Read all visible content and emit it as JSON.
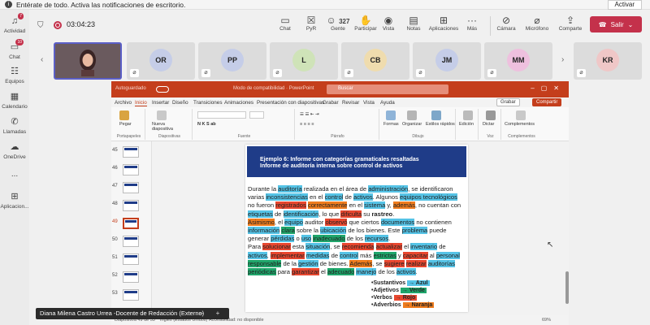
{
  "notification": {
    "text": "Entérate de todo. Activa las notificaciones de escritorio.",
    "activate_label": "Activar"
  },
  "rail": [
    {
      "label": "Actividad",
      "icon": "bell-icon",
      "badge": "7"
    },
    {
      "label": "Chat",
      "icon": "chat-icon",
      "badge": "10"
    },
    {
      "label": "Equipos",
      "icon": "teams-icon",
      "badge": ""
    },
    {
      "label": "Calendario",
      "icon": "calendar-icon",
      "badge": ""
    },
    {
      "label": "Llamadas",
      "icon": "phone-icon",
      "badge": ""
    },
    {
      "label": "OneDrive",
      "icon": "cloud-icon",
      "badge": ""
    },
    {
      "label": "...",
      "icon": "more-icon",
      "badge": ""
    },
    {
      "label": "Aplicacion...",
      "icon": "add-app-icon",
      "badge": ""
    }
  ],
  "meeting": {
    "timer": "03:04:23",
    "toolbar": {
      "chat": "Chat",
      "pyr": "PyR",
      "people_count": "327",
      "people": "Gente",
      "participate": "Participar",
      "view": "Vista",
      "notes": "Notas",
      "apps": "Aplicaciones",
      "more": "Más",
      "camera": "Cámara",
      "mic": "Micrófono",
      "share": "Comparte",
      "leave": "Salir"
    }
  },
  "participants": [
    {
      "initials": "",
      "self": true
    },
    {
      "initials": "OR",
      "color": "#c5cde8"
    },
    {
      "initials": "PP",
      "color": "#c5cde8"
    },
    {
      "initials": "L",
      "color": "#cfe3b8"
    },
    {
      "initials": "CB",
      "color": "#efdcae"
    },
    {
      "initials": "JM",
      "color": "#c5cde8"
    },
    {
      "initials": "MM",
      "color": "#eec0de"
    },
    {
      "initials": "KR",
      "color": "#efc7c7"
    }
  ],
  "powerpoint": {
    "autosave": "Autoguardado",
    "filename": "Modo de compatibilidad · PowerPoint",
    "search": "Buscar",
    "tabs": [
      "Archivo",
      "Inicio",
      "Insertar",
      "Diseño",
      "Transiciones",
      "Animaciones",
      "Presentación con diapositivas",
      "Grabar",
      "Revisar",
      "Vista",
      "Ayuda"
    ],
    "record_btn": "Grabar",
    "share_btn": "Compartir",
    "ribbon": {
      "paste": "Pegar",
      "clipboard": "Portapapeles",
      "new_slide": "Nueva diapositiva",
      "slides": "Diapositivas",
      "font": "Fuente",
      "paragraph": "Párrafo",
      "shapes": "Formas",
      "arrange": "Organizar",
      "styles": "Estilos rápidos",
      "drawing": "Dibujo",
      "edit": "Edición",
      "dictate": "Dictar",
      "voice": "Voz",
      "addins": "Complementos",
      "addins_group": "Complementos"
    },
    "thumbnails": [
      "45",
      "46",
      "47",
      "48",
      "49",
      "50",
      "51",
      "52",
      "53"
    ],
    "selected_thumb": "49",
    "slide": {
      "title1": "Ejemplo 6: Informe con categorías gramaticales resaltadas",
      "title2": "Informe de auditoría interna sobre control de activos",
      "p1": [
        {
          "t": "Durante la ",
          "h": ""
        },
        {
          "t": "auditoría",
          "h": "b"
        },
        {
          "t": " realizada en el área de ",
          "h": ""
        },
        {
          "t": "administración",
          "h": "b"
        },
        {
          "t": ", se identificaron varias ",
          "h": ""
        },
        {
          "t": "inconsistencias",
          "h": "b"
        },
        {
          "t": " en el ",
          "h": ""
        },
        {
          "t": "control",
          "h": "b"
        },
        {
          "t": " de ",
          "h": ""
        },
        {
          "t": "activos",
          "h": "b"
        },
        {
          "t": ". Algunos ",
          "h": ""
        },
        {
          "t": "equipos tecnológicos",
          "h": "b"
        },
        {
          "t": " no fueron ",
          "h": ""
        },
        {
          "t": "registrados",
          "h": "r"
        },
        {
          "t": " ",
          "h": ""
        },
        {
          "t": "correctamente",
          "h": "o"
        },
        {
          "t": " en el ",
          "h": ""
        },
        {
          "t": "sistema",
          "h": "b"
        },
        {
          "t": " y, ",
          "h": ""
        },
        {
          "t": "además",
          "h": "o"
        },
        {
          "t": ", no cuentan con ",
          "h": ""
        },
        {
          "t": "etiquetas",
          "h": "b"
        },
        {
          "t": " de ",
          "h": ""
        },
        {
          "t": "identificación",
          "h": "b"
        },
        {
          "t": ", lo que ",
          "h": ""
        },
        {
          "t": "dificulta",
          "h": "r"
        },
        {
          "t": " su ",
          "h": ""
        },
        {
          "t": "rastreo",
          "h": "bold"
        },
        {
          "t": ".",
          "h": ""
        }
      ],
      "p2": [
        {
          "t": "Asimismo",
          "h": "o"
        },
        {
          "t": ", el ",
          "h": ""
        },
        {
          "t": "equipo",
          "h": "b"
        },
        {
          "t": " auditor ",
          "h": ""
        },
        {
          "t": "observó",
          "h": "r"
        },
        {
          "t": " que ciertos ",
          "h": ""
        },
        {
          "t": "documentos",
          "h": "b"
        },
        {
          "t": " no contienen ",
          "h": ""
        },
        {
          "t": "información",
          "h": "b"
        },
        {
          "t": " ",
          "h": ""
        },
        {
          "t": "clara",
          "h": "g"
        },
        {
          "t": " sobre la ",
          "h": ""
        },
        {
          "t": "ubicación",
          "h": "b"
        },
        {
          "t": " de los bienes. Este ",
          "h": ""
        },
        {
          "t": "problema",
          "h": "b"
        },
        {
          "t": " puede generar ",
          "h": ""
        },
        {
          "t": "pérdidas",
          "h": "b"
        },
        {
          "t": " o ",
          "h": ""
        },
        {
          "t": "uso",
          "h": "b"
        },
        {
          "t": " ",
          "h": ""
        },
        {
          "t": "inadecuado",
          "h": "g"
        },
        {
          "t": " de los ",
          "h": ""
        },
        {
          "t": "recursos",
          "h": "b"
        },
        {
          "t": ".",
          "h": ""
        }
      ],
      "p3": [
        {
          "t": "Para ",
          "h": ""
        },
        {
          "t": "solucionar",
          "h": "r"
        },
        {
          "t": " esta ",
          "h": ""
        },
        {
          "t": "situación",
          "h": "b"
        },
        {
          "t": ", se ",
          "h": ""
        },
        {
          "t": "recomienda",
          "h": "r"
        },
        {
          "t": " ",
          "h": ""
        },
        {
          "t": "actualizar",
          "h": "r"
        },
        {
          "t": " el ",
          "h": ""
        },
        {
          "t": "inventario",
          "h": "b"
        },
        {
          "t": " de ",
          "h": ""
        },
        {
          "t": "activos",
          "h": "b"
        },
        {
          "t": ", ",
          "h": ""
        },
        {
          "t": "implementar",
          "h": "r"
        },
        {
          "t": " ",
          "h": ""
        },
        {
          "t": "medidas",
          "h": "b"
        },
        {
          "t": " de ",
          "h": ""
        },
        {
          "t": "control",
          "h": "b"
        },
        {
          "t": " más ",
          "h": ""
        },
        {
          "t": "estrictas",
          "h": "g"
        },
        {
          "t": " y ",
          "h": ""
        },
        {
          "t": "capacitar",
          "h": "r"
        },
        {
          "t": " al ",
          "h": ""
        },
        {
          "t": "personal",
          "h": "b"
        },
        {
          "t": " ",
          "h": ""
        },
        {
          "t": "responsable",
          "h": "g"
        },
        {
          "t": " de la ",
          "h": ""
        },
        {
          "t": "gestión",
          "h": "b"
        },
        {
          "t": " de bienes. ",
          "h": ""
        },
        {
          "t": "Además",
          "h": "o"
        },
        {
          "t": ", se ",
          "h": ""
        },
        {
          "t": "sugiere",
          "h": "r"
        },
        {
          "t": " ",
          "h": ""
        },
        {
          "t": "realizar",
          "h": "r"
        },
        {
          "t": " ",
          "h": ""
        },
        {
          "t": "auditorías",
          "h": "b"
        },
        {
          "t": " ",
          "h": ""
        },
        {
          "t": "periódicas",
          "h": "g"
        },
        {
          "t": " para ",
          "h": ""
        },
        {
          "t": "garantizar",
          "h": "r"
        },
        {
          "t": " el ",
          "h": ""
        },
        {
          "t": "adecuado",
          "h": "g"
        },
        {
          "t": " ",
          "h": ""
        },
        {
          "t": "manejo",
          "h": "b"
        },
        {
          "t": " de los ",
          "h": ""
        },
        {
          "t": "activos",
          "h": "b"
        },
        {
          "t": ".",
          "h": ""
        }
      ],
      "legend": [
        {
          "label": "•Sustantivos",
          "arrow": "→ Azul",
          "h": "b"
        },
        {
          "label": "•Adjetivos",
          "arrow": "→ Verde",
          "h": "g"
        },
        {
          "label": "•Verbos",
          "arrow": "→ Rojo",
          "h": "r"
        },
        {
          "label": "•Adverbios",
          "arrow": "→ Naranja",
          "h": "o"
        }
      ]
    },
    "status": {
      "slide_info": "Diapositiva 49 de 53",
      "lang": "Inglés (Estados Unidos)",
      "access": "Accesibilidad: no disponible",
      "zoom": "69%"
    }
  },
  "presenter_name": "Diana Milena Castro Urrea -Docente de Redacción (Externo)",
  "colors": {
    "teams_accent": "#5b5fc7",
    "leave_red": "#c4314b",
    "ppt_orange": "#c43e1c",
    "highlight_blue": "#55c3e6",
    "highlight_red": "#e8472f",
    "highlight_green": "#1fa66b",
    "highlight_orange": "#ef7c1e"
  }
}
